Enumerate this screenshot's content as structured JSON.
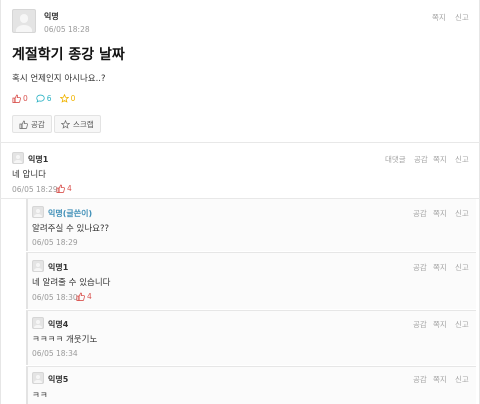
{
  "post": {
    "author": "익명",
    "datetime": "06/05 18:28",
    "actions": {
      "message": "쪽지",
      "report": "신고"
    },
    "title": "계절학기 종강 날짜",
    "body": "혹시 언제인지 아시나요..?",
    "stats": {
      "likes": "0",
      "comments": "6",
      "scraps": "0"
    },
    "buttons": {
      "like": "공감",
      "scrap": "스크랩"
    },
    "colors": {
      "like": "#d9534f",
      "comment": "#2bb2c4",
      "scrap": "#f0b400"
    }
  },
  "comments": [
    {
      "author": "익명1",
      "text": "네 압니다",
      "datetime": "06/05 18:29",
      "likes": "4",
      "actions": {
        "reply": "대댓글",
        "like": "공감",
        "message": "쪽지",
        "report": "신고"
      }
    }
  ],
  "replies": [
    {
      "author": "익명(글쓴이)",
      "text": "알려주실 수 있나요??",
      "datetime": "06/05 18:29",
      "likes": "",
      "actions": {
        "like": "공감",
        "message": "쪽지",
        "report": "신고"
      }
    },
    {
      "author": "익명1",
      "text": "네 알려줄 수 있습니다",
      "datetime": "06/05 18:30",
      "likes": "4",
      "actions": {
        "like": "공감",
        "message": "쪽지",
        "report": "신고"
      }
    },
    {
      "author": "익명4",
      "text": "ㅋㅋㅋㅋ 개웃기노",
      "datetime": "06/05 18:34",
      "likes": "",
      "actions": {
        "like": "공감",
        "message": "쪽지",
        "report": "신고"
      }
    },
    {
      "author": "익명5",
      "text": "ㅋㅋ",
      "datetime": "",
      "likes": "",
      "actions": {
        "like": "공감",
        "message": "쪽지",
        "report": "신고"
      }
    }
  ]
}
